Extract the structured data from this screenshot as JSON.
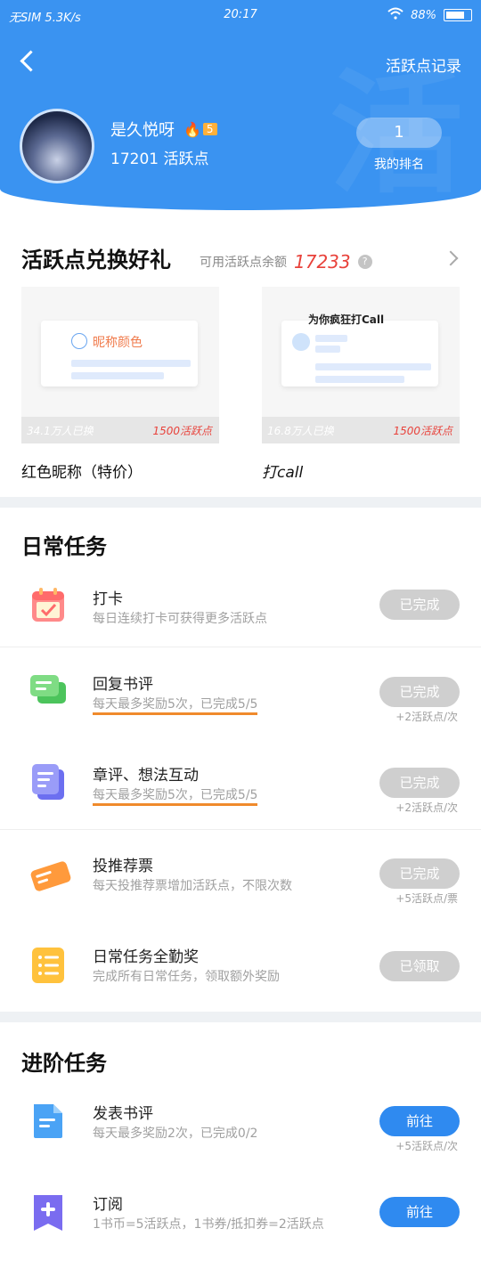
{
  "status_bar": {
    "carrier": "无SIM 5.3K/s",
    "time": "20:17",
    "battery": "88%"
  },
  "header": {
    "title": "活跃点记录",
    "watermark": "活"
  },
  "user": {
    "name": "是久悦呀",
    "level": "5",
    "points_label": "17201 活跃点",
    "rank_value": "1",
    "rank_label": "我的排名"
  },
  "shop": {
    "title": "活跃点兑换好礼",
    "balance_label": "可用活跃点余额",
    "balance": "17233",
    "help": "?",
    "items": [
      {
        "name": "红色昵称（特价）",
        "count": "34.1万人已换",
        "price": "1500活跃点",
        "preview_label": "昵称颜色"
      },
      {
        "name": "打call",
        "count": "16.8万人已换",
        "price": "1500活跃点",
        "preview_label": "为你疯狂打Call"
      }
    ]
  },
  "daily": {
    "title": "日常任务",
    "tasks": [
      {
        "name": "打卡",
        "desc": "每日连续打卡可获得更多活跃点",
        "button": "已完成",
        "reward": ""
      },
      {
        "name": "回复书评",
        "desc": "每天最多奖励5次，已完成5/5",
        "button": "已完成",
        "reward": "+2活跃点/次"
      },
      {
        "name": "章评、想法互动",
        "desc": "每天最多奖励5次，已完成5/5",
        "button": "已完成",
        "reward": "+2活跃点/次"
      },
      {
        "name": "投推荐票",
        "desc": "每天投推荐票增加活跃点，不限次数",
        "button": "已完成",
        "reward": "+5活跃点/票"
      },
      {
        "name": "日常任务全勤奖",
        "desc": "完成所有日常任务，领取额外奖励",
        "button": "已领取",
        "reward": ""
      }
    ]
  },
  "advanced": {
    "title": "进阶任务",
    "tasks": [
      {
        "name": "发表书评",
        "desc": "每天最多奖励2次，已完成0/2",
        "button": "前往",
        "reward": "+5活跃点/次"
      },
      {
        "name": "订阅",
        "desc": "1书币=5活跃点，1书券/抵扣券=2活跃点",
        "button": "前往",
        "reward": ""
      }
    ]
  },
  "colors": {
    "primary": "#3a93f1",
    "accent_red": "#e8413a",
    "button_done": "#cfcfcf",
    "button_go": "#2f8af0"
  }
}
